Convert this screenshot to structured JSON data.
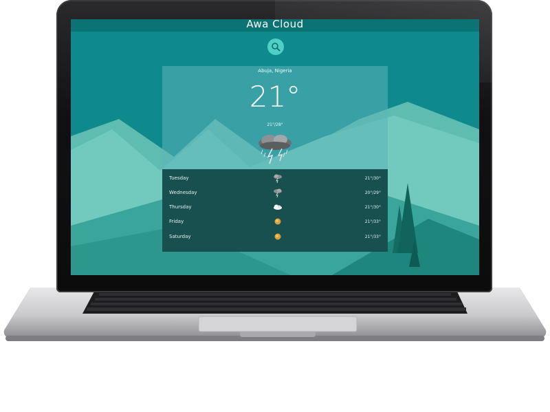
{
  "app": {
    "title": "Awa Cloud"
  },
  "search": {
    "icon": "search-icon"
  },
  "current": {
    "location": "Abuja, Nigeria",
    "temperature": "21°",
    "range": "21°/28°",
    "icon": "storm-cloud-icon"
  },
  "forecast": [
    {
      "day": "Tuesday",
      "icon": "storm-cloud-icon",
      "range": "21°/30°"
    },
    {
      "day": "Wednesday",
      "icon": "storm-cloud-icon",
      "range": "20°/29°"
    },
    {
      "day": "Thursday",
      "icon": "cloud-icon",
      "range": "21°/30°"
    },
    {
      "day": "Friday",
      "icon": "sun-icon",
      "range": "21°/33°"
    },
    {
      "day": "Saturday",
      "icon": "sun-icon",
      "range": "21°/33°"
    }
  ],
  "colors": {
    "accent": "#4fd0c6",
    "background": "#0e8a8c",
    "mountain_light": "#72c9bd",
    "forecast_panel": "#17504f",
    "sun": "#d9a23a"
  }
}
